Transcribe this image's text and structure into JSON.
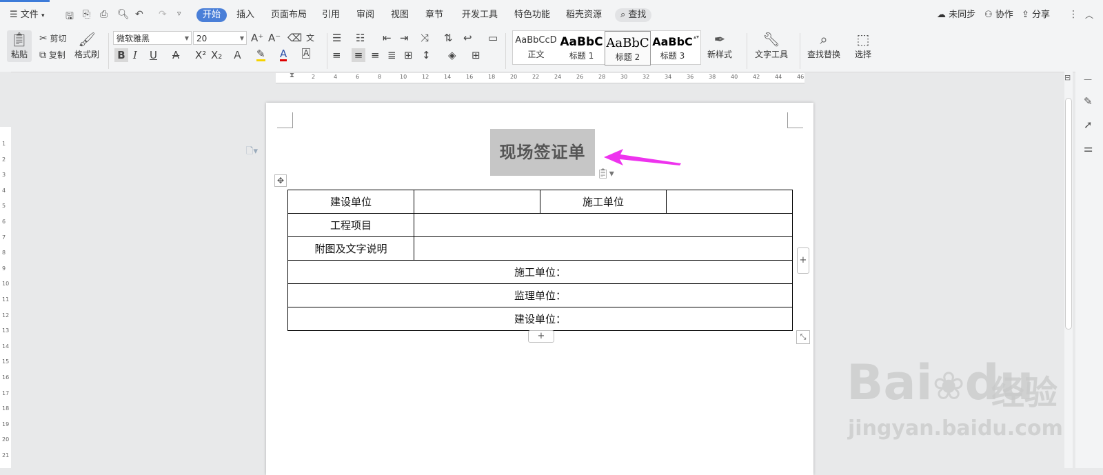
{
  "menubar": {
    "file": "文件",
    "tabs": [
      "开始",
      "插入",
      "页面布局",
      "引用",
      "审阅",
      "视图",
      "章节",
      "开发工具",
      "特色功能",
      "稻壳资源"
    ],
    "active_tab": "开始",
    "search": "查找",
    "sync": "未同步",
    "collab": "协作",
    "share": "分享"
  },
  "ribbon": {
    "paste": "粘贴",
    "cut": "剪切",
    "copy": "复制",
    "format_painter": "格式刷",
    "font_name": "微软雅黑",
    "font_size": "20",
    "styles": [
      {
        "sample": "AaBbCcD",
        "name": "正文"
      },
      {
        "sample": "AaBbC",
        "name": "标题 1"
      },
      {
        "sample": "AaBbC",
        "name": "标题 2"
      },
      {
        "sample": "AaBbC",
        "name": "标题 3"
      }
    ],
    "selected_style": "标题 2",
    "new_style": "新样式",
    "text_tools": "文字工具",
    "find_replace": "查找替换",
    "select": "选择"
  },
  "ruler": {
    "h_marks": [
      "2",
      "4",
      "6",
      "8",
      "10",
      "12",
      "14",
      "16",
      "18",
      "20",
      "22",
      "24",
      "26",
      "28",
      "30",
      "32",
      "34",
      "36",
      "38",
      "40",
      "42",
      "44",
      "46"
    ],
    "v_marks": [
      "1",
      "2",
      "3",
      "4",
      "5",
      "6",
      "7",
      "8",
      "9",
      "10",
      "11",
      "12",
      "13",
      "14",
      "15",
      "16",
      "17",
      "18",
      "19",
      "20",
      "21"
    ]
  },
  "document": {
    "title": "现场签证单",
    "table": {
      "row1": [
        "建设单位",
        "",
        "施工单位",
        ""
      ],
      "row2": [
        "工程项目",
        ""
      ],
      "row3": [
        "附图及文字说明",
        ""
      ],
      "row4": "施工单位：",
      "row5": "监理单位：",
      "row6": "建设单位："
    }
  },
  "colors": {
    "accent": "#4a7fd8",
    "arrow": "#ee33ee",
    "title_highlight": "#c6c6c6"
  },
  "watermark": {
    "brand": "Bai",
    "brand2": "du",
    "cn": "经验",
    "url": "jingyan.baidu.com"
  }
}
